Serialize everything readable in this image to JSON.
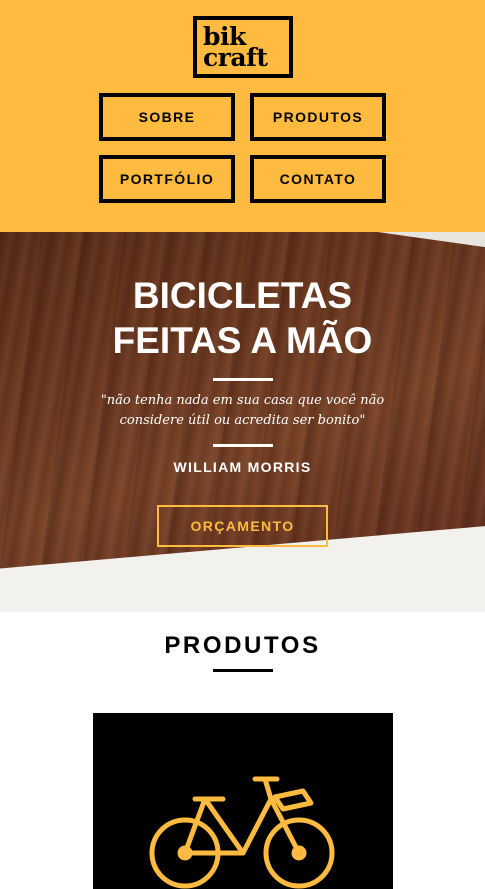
{
  "brand": {
    "logo_line1": "bik",
    "logo_line2": "craft",
    "accent_color": "#FEBB3F"
  },
  "nav": {
    "items": [
      {
        "label": "SOBRE"
      },
      {
        "label": "PRODUTOS"
      },
      {
        "label": "PORTFÓLIO"
      },
      {
        "label": "CONTATO"
      }
    ]
  },
  "hero": {
    "title_line1": "BICICLETAS",
    "title_line2": "FEITAS A MÃO",
    "quote_line1": "\"não tenha nada em sua casa que você não",
    "quote_line2": "considere útil ou acredita ser bonito\"",
    "author": "WILLIAM MORRIS",
    "cta_label": "ORÇAMENTO"
  },
  "products": {
    "title": "PRODUTOS",
    "items": [
      {
        "icon": "bicycle-icon"
      }
    ]
  }
}
